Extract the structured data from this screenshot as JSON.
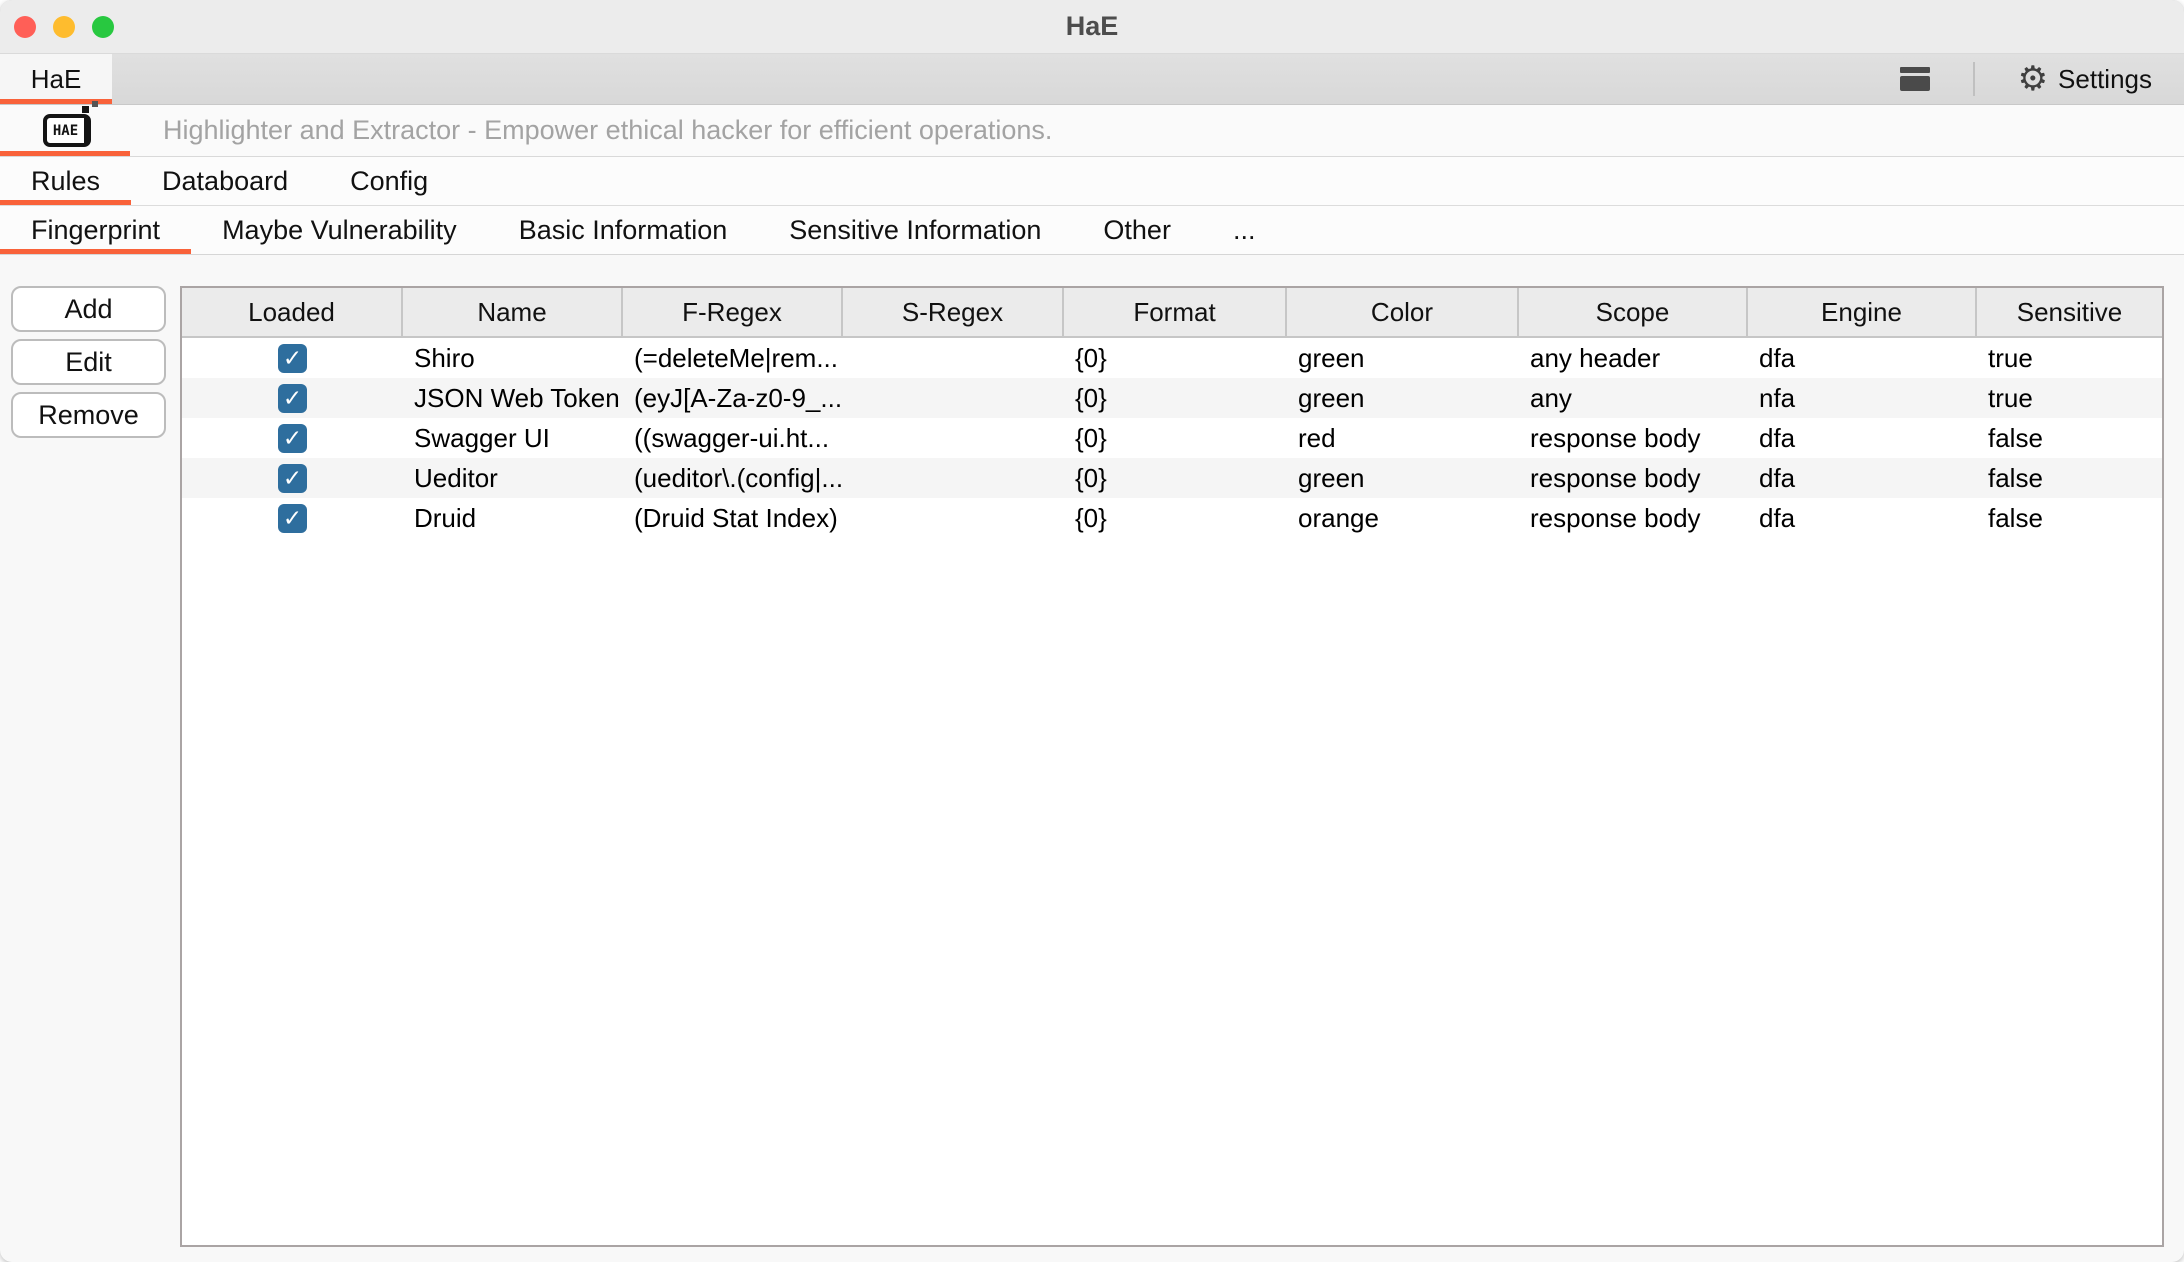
{
  "window": {
    "title": "HaE"
  },
  "suite_tab_bar": {
    "tab_label": "HaE",
    "settings_label": "Settings"
  },
  "banner": {
    "logo_text": "HAE",
    "subtitle": "Highlighter and Extractor - Empower ethical hacker for efficient operations."
  },
  "main_tabs": {
    "items": [
      {
        "label": "Rules",
        "active": true
      },
      {
        "label": "Databoard",
        "active": false
      },
      {
        "label": "Config",
        "active": false
      }
    ]
  },
  "sub_tabs": {
    "items": [
      {
        "label": "Fingerprint",
        "active": true
      },
      {
        "label": "Maybe Vulnerability",
        "active": false
      },
      {
        "label": "Basic Information",
        "active": false
      },
      {
        "label": "Sensitive Information",
        "active": false
      },
      {
        "label": "Other",
        "active": false
      },
      {
        "label": "...",
        "active": false
      }
    ]
  },
  "actions": {
    "add_label": "Add",
    "edit_label": "Edit",
    "remove_label": "Remove"
  },
  "table": {
    "columns": [
      "Loaded",
      "Name",
      "F-Regex",
      "S-Regex",
      "Format",
      "Color",
      "Scope",
      "Engine",
      "Sensitive"
    ],
    "rows": [
      {
        "loaded": true,
        "name": "Shiro",
        "f_regex": "(=deleteMe|rem...",
        "s_regex": "",
        "format": "{0}",
        "color": "green",
        "scope": "any header",
        "engine": "dfa",
        "sensitive": "true"
      },
      {
        "loaded": true,
        "name": "JSON Web Token",
        "f_regex": "(eyJ[A-Za-z0-9_...",
        "s_regex": "",
        "format": "{0}",
        "color": "green",
        "scope": "any",
        "engine": "nfa",
        "sensitive": "true"
      },
      {
        "loaded": true,
        "name": "Swagger UI",
        "f_regex": "((swagger-ui.ht...",
        "s_regex": "",
        "format": "{0}",
        "color": "red",
        "scope": "response body",
        "engine": "dfa",
        "sensitive": "false"
      },
      {
        "loaded": true,
        "name": "Ueditor",
        "f_regex": "(ueditor\\.(config|...",
        "s_regex": "",
        "format": "{0}",
        "color": "green",
        "scope": "response body",
        "engine": "dfa",
        "sensitive": "false"
      },
      {
        "loaded": true,
        "name": "Druid",
        "f_regex": "(Druid Stat Index)",
        "s_regex": "",
        "format": "{0}",
        "color": "orange",
        "scope": "response body",
        "engine": "dfa",
        "sensitive": "false"
      }
    ]
  },
  "icons": {
    "gear_glyph": "⚙",
    "check_glyph": "✓"
  },
  "colors": {
    "accent_orange": "#f9623a",
    "checkbox_blue": "#2e6e9e",
    "traffic_red": "#ff5f57",
    "traffic_yellow": "#febc2e",
    "traffic_green": "#28c840"
  }
}
